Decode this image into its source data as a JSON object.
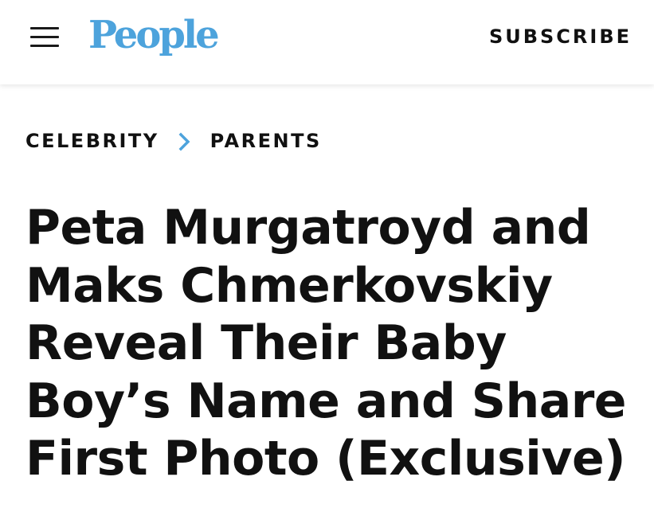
{
  "header": {
    "logo_text": "People",
    "subscribe_label": "SUBSCRIBE",
    "menu_icon": "hamburger-menu-icon",
    "logo_color": "#4da3dc"
  },
  "breadcrumb": {
    "items": [
      {
        "label": "CELEBRITY"
      },
      {
        "label": "PARENTS"
      }
    ],
    "separator_icon": "chevron-right-icon",
    "separator_color": "#4da3dc"
  },
  "article": {
    "headline": "Peta Murgatroyd and Maks Chmerkovskiy Reveal Their Baby Boy’s Name and Share First Photo (Exclusive)"
  }
}
